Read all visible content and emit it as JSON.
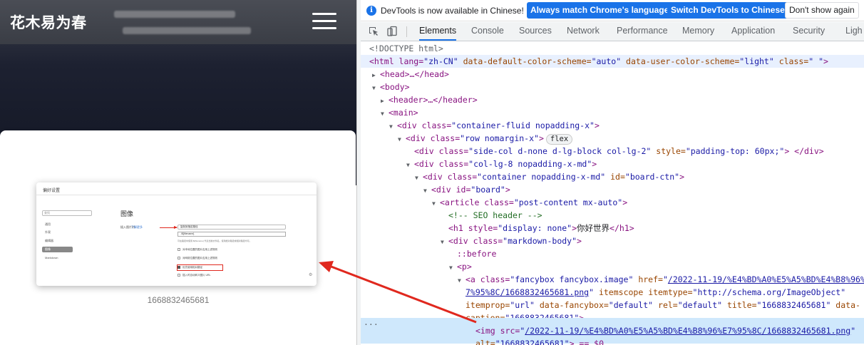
{
  "blog": {
    "site_title": "花木易为春",
    "image_caption": "1668832465681",
    "screenshot": {
      "dialog_title": "偏好设置",
      "search_placeholder": "查找",
      "nav_items": [
        "通用",
        "外观",
        "编辑器",
        "图像",
        "Markdown"
      ],
      "active_nav_index": 3,
      "heading": "图像",
      "label_insert": "插入图片时…",
      "link_text": "了解更多",
      "select_value": "复制到指定路径",
      "input_value": "./${filename}",
      "help_text": "可在路径中使用 ${filename} 代表当前文件名，使用绝对路径或相对路径均可。",
      "checkboxes": [
        "对本地位置的图片应用上述规则",
        "对网络位置的图片应用上述规则",
        "优先使用相对路径",
        "插入时自动转义图片 URL"
      ],
      "highlighted_checkbox_index": 2
    }
  },
  "devtools": {
    "infobar": {
      "message": "DevTools is now available in Chinese!",
      "btn_match": "Always match Chrome's language",
      "btn_switch": "Switch DevTools to Chinese",
      "btn_dismiss": "Don't show again"
    },
    "tabs": [
      "Elements",
      "Console",
      "Sources",
      "Network",
      "Performance",
      "Memory",
      "Application",
      "Security",
      "Ligh"
    ],
    "active_tab": "Elements",
    "icons": [
      "inspect-icon",
      "device-toolbar-icon"
    ],
    "dom": {
      "doctype": "<!DOCTYPE html>",
      "html_open_a": "<html lang=",
      "html_lang": "\"zh-CN\"",
      "html_attr2": " data-default-color-scheme=",
      "html_attr2_val": "\"auto\"",
      "html_attr3": " data-user-color-scheme=",
      "html_attr3_val": "\"light\"",
      "html_attr4": " class=",
      "html_attr4_val": "\" \"",
      "html_close": ">",
      "head": "<head>…</head>",
      "body": "<body>",
      "header": "<header>…</header>",
      "main": "<main>",
      "div1": "<div class=",
      "div1_val": "\"container-fluid nopadding-x\"",
      "div2_val": "\"row nomargin-x\"",
      "flex_badge": "flex",
      "div3_val": "\"side-col d-none d-lg-block col-lg-2\"",
      "div3_style": " style=",
      "div3_style_val": "\"padding-top: 60px;\"",
      "div3_end": "> </div>",
      "div4_val": "\"col-lg-8 nopadding-x-md\"",
      "div5_val": "\"container nopadding-x-md\"",
      "div5_id": " id=",
      "div5_id_val": "\"board-ctn\"",
      "div6_open": "<div id=",
      "div6_val": "\"board\"",
      "article_open": "<article class=",
      "article_val": "\"post-content mx-auto\"",
      "comment": "<!-- SEO header -->",
      "h1_open": "<h1 style=",
      "h1_val": "\"display: none\"",
      "h1_text": "你好世界",
      "h1_close": "</h1>",
      "div7_val": "\"markdown-body\"",
      "before": "::before",
      "p": "<p>",
      "a_open": "<a class=",
      "a_class": "\"fancybox fancybox.image\"",
      "a_href_attr": " href=",
      "a_href_q": "\"",
      "a_href_1": "/2022-11-19/%E4%BD%A0%E5%A5%BD%E4%B8%96%E",
      "a_href_2": "7%95%8C/1668832465681.png",
      "a_itemscope": " itemscope itemtype=",
      "a_itemtype": "\"http://schema.org/ImageObject\"",
      "a_itemprop": "itemprop=",
      "a_itemprop_val": "\"url\"",
      "a_fancy": " data-fancybox=",
      "a_fancy_val": "\"default\"",
      "a_rel": " rel=",
      "a_rel_val": "\"default\"",
      "a_title": " title=",
      "a_title_val": "\"1668832465681\"",
      "a_data": " data-",
      "a_caption": "caption=",
      "a_caption_val": "\"1668832465681\"",
      "img_open": "<img src=",
      "img_src": "/2022-11-19/%E4%BD%A0%E5%A5%BD%E4%B8%96%E7%95%8C/1668832465681.png",
      "img_alt": "alt=",
      "img_alt_val": "\"1668832465681\"",
      "img_end": "> == $0",
      "ellipsis": "···"
    }
  },
  "colors": {
    "accent": "#1a73e8",
    "annotation_red": "#e0281e",
    "selected_row": "#cfe8fc"
  }
}
